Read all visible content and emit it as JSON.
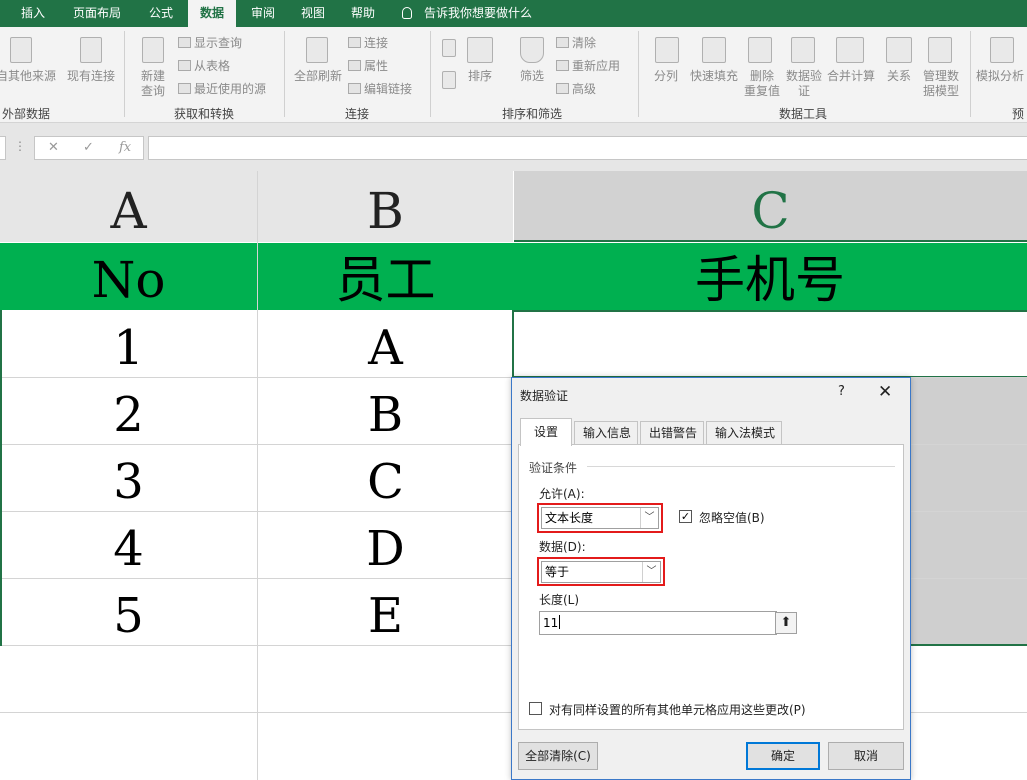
{
  "ribbon_tabs": {
    "insert": "插入",
    "page_layout": "页面布局",
    "formulas": "公式",
    "data": "数据",
    "review": "审阅",
    "view": "视图",
    "help": "帮助"
  },
  "tell_me": "告诉我你想要做什么",
  "ribbon": {
    "get_external": "自其他来源",
    "existing_connections": "现有连接",
    "new_query": [
      "新建",
      "查询"
    ],
    "show_queries": "显示查询",
    "from_table": "从表格",
    "recent_sources": "最近使用的源",
    "refresh_all": "全部刷新",
    "connections": "连接",
    "properties": "属性",
    "edit_links": "编辑链接",
    "sort": "排序",
    "filter": "筛选",
    "clear": "清除",
    "reapply": "重新应用",
    "advanced": "高级",
    "text_to_columns": "分列",
    "flash_fill": "快速填充",
    "remove_duplicates": [
      "删除",
      "重复值"
    ],
    "data_validation": [
      "数据验",
      "证"
    ],
    "consolidate": "合并计算",
    "relationships": "关系",
    "manage_model": [
      "管理数",
      "据模型"
    ],
    "what_if": "模拟分析",
    "groups": {
      "external": "外部数据",
      "get_transform": "获取和转换",
      "connections": "连接",
      "sort_filter": "排序和筛选",
      "data_tools": "数据工具",
      "forecast": "预"
    }
  },
  "formula_bar": {
    "cancel": "✕",
    "enter": "✓",
    "fx": "fx",
    "value": ""
  },
  "sheet": {
    "columns": [
      "A",
      "B",
      "C"
    ],
    "header": [
      "No",
      "员工",
      "手机号"
    ],
    "rows": [
      {
        "no": "1",
        "emp": "A"
      },
      {
        "no": "2",
        "emp": "B"
      },
      {
        "no": "3",
        "emp": "C"
      },
      {
        "no": "4",
        "emp": "D"
      },
      {
        "no": "5",
        "emp": "E"
      }
    ],
    "colors": {
      "header_fill": "#00b050",
      "selection": "#217346"
    }
  },
  "dialog": {
    "title": "数据验证",
    "help": "?",
    "close": "✕",
    "tabs": [
      "设置",
      "输入信息",
      "出错警告",
      "输入法模式"
    ],
    "section": "验证条件",
    "allow_label": "允许(A):",
    "allow_value": "文本长度",
    "ignore_blank": "忽略空值(B)",
    "ignore_blank_checked": true,
    "data_label": "数据(D):",
    "data_value": "等于",
    "length_label": "长度(L)",
    "length_value": "11",
    "apply_all": "对有同样设置的所有其他单元格应用这些更改(P)",
    "apply_all_checked": false,
    "clear_all": "全部清除(C)",
    "ok": "确定",
    "cancel": "取消"
  }
}
